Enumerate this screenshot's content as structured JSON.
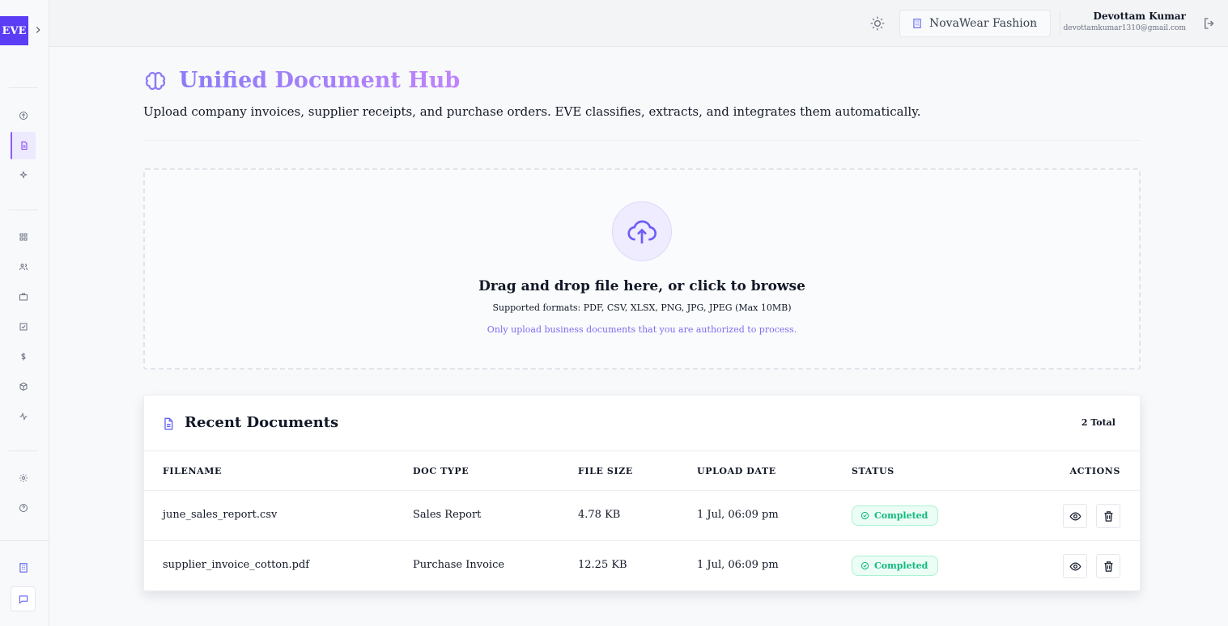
{
  "brand": {
    "logo_text": "EVE",
    "accent": "#5b3df5"
  },
  "sidebar": {
    "groups": [
      [
        "brain-icon",
        "document-icon",
        "sparkles-icon"
      ],
      [
        "grid-icon",
        "users-icon",
        "briefcase-icon",
        "check-square-icon",
        "dollar-icon",
        "package-icon",
        "activity-icon"
      ],
      [
        "gear-icon",
        "help-circle-icon"
      ]
    ],
    "active": "document-icon",
    "bottom": [
      "building-icon",
      "chat-icon"
    ]
  },
  "header": {
    "org": "NovaWear Fashion",
    "user_name": "Devottam Kumar",
    "user_email": "devottamkumar1310@gmail.com"
  },
  "page": {
    "title": "Unified Document Hub",
    "subtitle": "Upload company invoices, supplier receipts, and purchase orders. EVE classifies, extracts, and integrates them automatically."
  },
  "dropzone": {
    "title": "Drag and drop file here, or click to browse",
    "formats": "Supported formats: PDF, CSV, XLSX, PNG, JPG, JPEG (Max 10MB)",
    "note": "Only upload business documents that you are authorized to process."
  },
  "recent": {
    "title": "Recent Documents",
    "total": "2 Total",
    "columns": {
      "filename": "FILENAME",
      "doc_type": "DOC TYPE",
      "file_size": "FILE SIZE",
      "upload_date": "UPLOAD DATE",
      "status": "STATUS",
      "actions": "ACTIONS"
    },
    "rows": [
      {
        "filename": "june_sales_report.csv",
        "doc_type": "Sales Report",
        "file_size": "4.78 KB",
        "upload_date": "1 Jul, 06:09 pm",
        "status": "Completed"
      },
      {
        "filename": "supplier_invoice_cotton.pdf",
        "doc_type": "Purchase Invoice",
        "file_size": "12.25 KB",
        "upload_date": "1 Jul, 06:09 pm",
        "status": "Completed"
      }
    ],
    "status_color": "#10b981"
  }
}
